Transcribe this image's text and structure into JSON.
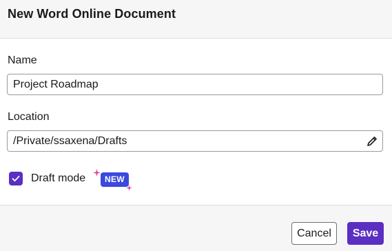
{
  "dialog": {
    "title": "New Word Online Document"
  },
  "name_field": {
    "label": "Name",
    "value": "Project Roadmap"
  },
  "location_field": {
    "label": "Location",
    "value": "/Private/ssaxena/Drafts",
    "edit_icon": "pencil-icon"
  },
  "draft_mode": {
    "label": "Draft mode",
    "checked": true,
    "badge": "NEW"
  },
  "footer": {
    "cancel_label": "Cancel",
    "save_label": "Save"
  },
  "colors": {
    "accent": "#5a2fc2",
    "badge": "#3b49df",
    "sparkle": "#e0409a"
  }
}
